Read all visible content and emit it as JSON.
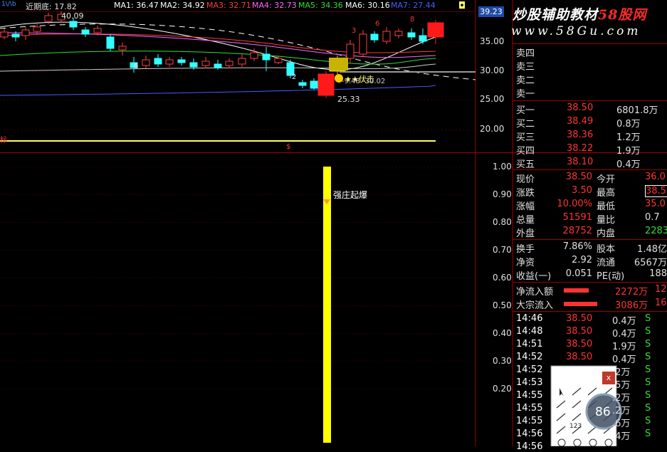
{
  "header": {
    "left_label": "近期底: 17.82",
    "ma": [
      {
        "label": "MA1: 36.47",
        "color": "#ffffff"
      },
      {
        "label": "MA2: 34.92",
        "color": "#ffffff"
      },
      {
        "label": "MA3: 32.71",
        "color": "#ff3c3c"
      },
      {
        "label": "MA4: 32.73",
        "color": "#ff66ff"
      },
      {
        "label": "MA5: 34.36",
        "color": "#33dd33"
      },
      {
        "label": "MA6: 30.16",
        "color": "#ffffff"
      },
      {
        "label": "MA7: 27.44",
        "color": "#4a5cff"
      }
    ],
    "price_box": "39.23"
  },
  "watermark": {
    "line1a": "炒股辅助教材",
    "line1b": "58股网",
    "line2": "www.58Gu.com"
  },
  "main_axis": [
    "35.00",
    "30.00",
    "25.00",
    "20.00"
  ],
  "indicator_axis": [
    "1.00",
    "0.90",
    "0.80",
    "0.70",
    "0.60",
    "0.50",
    "0.40",
    "0.30",
    "0.20"
  ],
  "chart_labels": {
    "high": "40.09",
    "low": "25.33",
    "buy_signal": "★★伏击",
    "buy_sub": "-9.48 -30.02",
    "indicator_signal": "强庄起爆",
    "red_left": "标",
    "red_center": "$",
    "counts": [
      "3",
      "6",
      "8",
      "2",
      "8"
    ]
  },
  "order_book": {
    "sells": [
      {
        "label": "卖四"
      },
      {
        "label": "卖三"
      },
      {
        "label": "卖二"
      },
      {
        "label": "卖一"
      }
    ],
    "buys": [
      {
        "label": "买一",
        "price": "38.50",
        "vol": "6801.8万"
      },
      {
        "label": "买二",
        "price": "38.49",
        "vol": "0.8万"
      },
      {
        "label": "买三",
        "price": "38.36",
        "vol": "1.2万"
      },
      {
        "label": "买四",
        "price": "38.22",
        "vol": "1.9万"
      },
      {
        "label": "买五",
        "price": "38.10",
        "vol": "0.4万"
      }
    ]
  },
  "stats": [
    {
      "k1": "现价",
      "v1": "38.50",
      "k2": "今开",
      "v2": "36.0"
    },
    {
      "k1": "涨跌",
      "v1": "3.50",
      "k2": "最高",
      "v2": "38.5"
    },
    {
      "k1": "涨幅",
      "v1": "10.00%",
      "k2": "最低",
      "v2": "35.0"
    },
    {
      "k1": "总量",
      "v1": "51591",
      "k2": "量比",
      "v2": "0.7"
    },
    {
      "k1": "外盘",
      "v1": "28752",
      "k2": "内盘",
      "v2": "2283"
    }
  ],
  "finance": [
    {
      "k1": "换手",
      "v1": "7.86%",
      "k2": "股本",
      "v2": "1.48亿"
    },
    {
      "k1": "净资",
      "v1": "2.92",
      "k2": "流通",
      "v2": "6567万"
    },
    {
      "k1": "收益(一)",
      "v1": "0.051",
      "k2": "PE(动)",
      "v2": "188"
    }
  ],
  "flows": [
    {
      "label": "净流入额",
      "value": "2272万",
      "extra": "12"
    },
    {
      "label": "大宗流入",
      "value": "3086万",
      "extra": "16"
    }
  ],
  "ticks": [
    {
      "time": "14:46",
      "price": "38.50",
      "vol": "0.4万",
      "side": "S"
    },
    {
      "time": "14:48",
      "price": "38.50",
      "vol": "0.4万",
      "side": "S"
    },
    {
      "time": "14:51",
      "price": "38.50",
      "vol": "1.9万",
      "side": "S"
    },
    {
      "time": "14:52",
      "price": "38.50",
      "vol": "0.4万",
      "side": "S"
    },
    {
      "time": "14:52",
      "price": "",
      "vol": ".2万",
      "side": "S"
    },
    {
      "time": "14:53",
      "price": "",
      "vol": ".5万",
      "side": "S"
    },
    {
      "time": "14:55",
      "price": "",
      "vol": ".2万",
      "side": "S"
    },
    {
      "time": "14:55",
      "price": "",
      "vol": ".2万",
      "side": "S"
    },
    {
      "time": "14:55",
      "price": "",
      "vol": ".6万",
      "side": "S"
    },
    {
      "time": "14:56",
      "price": "",
      "vol": ".4万",
      "side": "S"
    },
    {
      "time": "14:56",
      "price": "",
      "vol": "",
      "side": ""
    }
  ],
  "toolbox": {
    "close": "x",
    "badge": "86",
    "label_123": "123"
  },
  "colors": {
    "up": "#ff3333",
    "down": "#33ffff",
    "signal": "#ffff00",
    "axis": "#a00000",
    "price": "#ff3333"
  }
}
